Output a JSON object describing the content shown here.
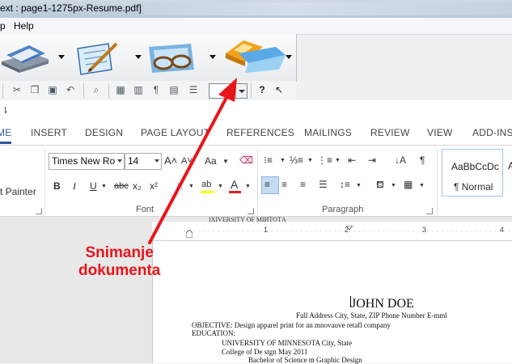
{
  "window": {
    "title": "ext : page1-1275px-Resume.pdf]"
  },
  "menubar": {
    "items": [
      "p",
      "Help"
    ]
  },
  "toolbar": {
    "zoom_value": ""
  },
  "word": {
    "tabs": [
      {
        "label": "ME",
        "active": true
      },
      {
        "label": "INSERT"
      },
      {
        "label": "DESIGN"
      },
      {
        "label": "PAGE LAYOUT"
      },
      {
        "label": "REFERENCES"
      },
      {
        "label": "MAILINGS"
      },
      {
        "label": "REVIEW"
      },
      {
        "label": "VIEW"
      },
      {
        "label": "ADD-INS"
      }
    ],
    "clipboard": {
      "format_painter": "t Painter"
    },
    "font": {
      "name": "Times New Ro",
      "size": "14",
      "group_label": "Font",
      "bold": "B",
      "italic": "I",
      "underline": "U",
      "strike": "abc",
      "change_case": "Aa"
    },
    "paragraph": {
      "group_label": "Paragraph"
    },
    "styles": {
      "preview": "AaBbCcDc",
      "name": "¶ Normal",
      "next_preview": "A"
    },
    "ruler": {
      "marks": [
        "1",
        "2",
        "3",
        "4"
      ]
    }
  },
  "document": {
    "cut_line": "IXIVERSITY OF MIИТОТA",
    "name": "JOHN DOE",
    "address": "Full Address City, State, ZIP Phone Number E-mml",
    "objective": "OBJECTIVE: Design apparel print for an mnovauve retafl company",
    "education": "EDUCATION:",
    "university": "UNIVERSITY OF MINNESOTA City, State",
    "college": "College of De stgn May 2011",
    "degree": "Bachelor of Science m Graphic Design"
  },
  "annotation": {
    "line1": "Snimanje",
    "line2": "dokumenta",
    "color": "#e8151a"
  }
}
